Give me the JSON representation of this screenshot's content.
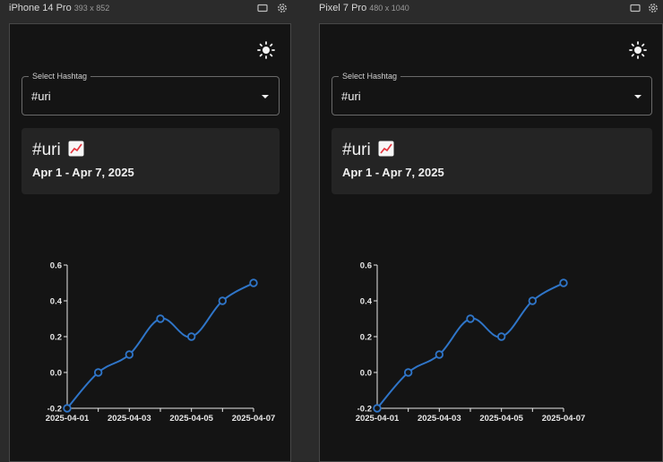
{
  "devices": [
    {
      "name": "iPhone 14 Pro",
      "size": "393 x 852",
      "select": {
        "label": "Select Hashtag",
        "value": "#uri"
      },
      "card": {
        "title": "#uri",
        "date_range": "Apr 1 - Apr 7, 2025"
      }
    },
    {
      "name": "Pixel 7 Pro",
      "size": "480 x 1040",
      "select": {
        "label": "Select Hashtag",
        "value": "#uri"
      },
      "card": {
        "title": "#uri",
        "date_range": "Apr 1 - Apr 7, 2025"
      }
    }
  ],
  "icons": {
    "header": [
      "rotate-screen-icon",
      "settings-icon"
    ],
    "theme_toggle": "sun-icon",
    "select_arrow": "dropdown-arrow-icon",
    "trend": "chart-increasing-icon"
  },
  "colors": {
    "line": "#2f75c8",
    "axis": "#e8e8e8",
    "screen_bg": "#141414",
    "card_bg": "#242424"
  },
  "chart_data": [
    {
      "type": "line",
      "x": [
        "2025-04-01",
        "2025-04-02",
        "2025-04-03",
        "2025-04-04",
        "2025-04-05",
        "2025-04-06",
        "2025-04-07"
      ],
      "y": [
        -0.2,
        0.0,
        0.1,
        0.3,
        0.2,
        0.4,
        0.5
      ],
      "x_tick_labels": [
        "2025-04-01",
        "2025-04-03",
        "2025-04-05",
        "2025-04-07"
      ],
      "y_ticks": [
        "-0.2",
        "0.0",
        "0.2",
        "0.4",
        "0.6"
      ],
      "ylim": [
        -0.2,
        0.6
      ],
      "grid": false,
      "legend": "none"
    },
    {
      "type": "line",
      "x": [
        "2025-04-01",
        "2025-04-02",
        "2025-04-03",
        "2025-04-04",
        "2025-04-05",
        "2025-04-06",
        "2025-04-07"
      ],
      "y": [
        -0.2,
        0.0,
        0.1,
        0.3,
        0.2,
        0.4,
        0.5
      ],
      "x_tick_labels": [
        "2025-04-01",
        "2025-04-03",
        "2025-04-05",
        "2025-04-07"
      ],
      "y_ticks": [
        "-0.2",
        "0.0",
        "0.2",
        "0.4",
        "0.6"
      ],
      "ylim": [
        -0.2,
        0.6
      ],
      "grid": false,
      "legend": "none"
    }
  ]
}
